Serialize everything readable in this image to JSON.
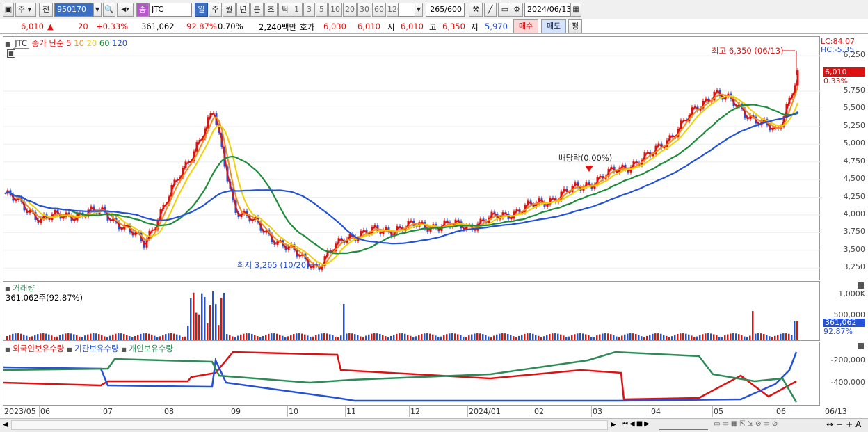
{
  "toolbar": {
    "period_select": "주",
    "prev_label": "전",
    "code": "950170",
    "type_badge": "종",
    "name": "JTC",
    "periods": [
      "일",
      "주",
      "월",
      "년",
      "분",
      "초",
      "틱"
    ],
    "active_period": "일",
    "intervals": [
      "1",
      "3",
      "5",
      "10",
      "20",
      "30",
      "60",
      "120"
    ],
    "count": "265",
    "count_total": "/600",
    "date": "2024/06/13"
  },
  "quote": {
    "price": "6,010",
    "direction": "▲",
    "change": "20",
    "change_pct": "+0.33%",
    "volume": "361,062",
    "vol_ratio": "92.87%",
    "turnover_pct": "0.70%",
    "amount": "2,240백만",
    "bid_label": "호가",
    "bid1": "6,030",
    "bid2": "6,010",
    "open_label": "시",
    "open": "6,010",
    "high_label": "고",
    "high": "6,350",
    "low_label": "저",
    "low": "5,970",
    "buy_label": "매수",
    "sell_label": "매도",
    "avg_label": "평"
  },
  "main_legend": {
    "code": "JTC",
    "name": "종가 단순",
    "ma": [
      "5",
      "10",
      "20",
      "60",
      "120"
    ],
    "ma_colors": [
      "#d11",
      "#f28c16",
      "#f0d000",
      "#1e8c3a",
      "#2451d6"
    ]
  },
  "price_axis": {
    "lc": "LC:84.07",
    "hc": "HC:-5.35",
    "ticks": [
      "6,250",
      "5,750",
      "5,500",
      "5,250",
      "5,000",
      "4,750",
      "4,500",
      "4,250",
      "4,000",
      "3,750",
      "3,500",
      "3,250"
    ],
    "current": "6,010",
    "current_pct": "0.33%"
  },
  "annotations": {
    "high": "최고 6,350 (06/13)",
    "low": "최저 3,265 (10/20)",
    "dividend": "배당락(0.00%)"
  },
  "volume_panel": {
    "title": "거래량",
    "value": "361,062주(92.87%)",
    "ticks": [
      "1,000K",
      "500,000"
    ],
    "current": "361,062",
    "current_pct": "92.87%"
  },
  "owner_panel": {
    "legend": [
      "외국인보유수량",
      "기관보유수량",
      "개인보유수량"
    ],
    "colors": [
      "#d11",
      "#2451d6",
      "#2e8b57"
    ],
    "ticks": [
      "-200,000",
      "-400,000"
    ]
  },
  "x_axis": [
    "2023/05",
    "06",
    "07",
    "08",
    "09",
    "10",
    "11",
    "12",
    "2024/01",
    "02",
    "03",
    "04",
    "05",
    "06"
  ],
  "x_end": "06/13",
  "chart_data": {
    "type": "line",
    "title": "JTC 950170 daily",
    "ylim": [
      3125,
      6350
    ],
    "close_series_approx": [
      {
        "date": "2023/05",
        "close": 4300
      },
      {
        "date": "2023/06",
        "close": 3950
      },
      {
        "date": "2023/07",
        "close": 4050
      },
      {
        "date": "2023/08",
        "close": 3600
      },
      {
        "date": "2023/08 late",
        "close": 5450
      },
      {
        "date": "2023/09",
        "close": 4100
      },
      {
        "date": "2023/10",
        "close": 3500
      },
      {
        "date": "2023/10/20",
        "close": 3265
      },
      {
        "date": "2023/11",
        "close": 3700
      },
      {
        "date": "2023/12",
        "close": 3850
      },
      {
        "date": "2024/01",
        "close": 3850
      },
      {
        "date": "2024/02",
        "close": 4150
      },
      {
        "date": "2024/03",
        "close": 4450
      },
      {
        "date": "2024/04",
        "close": 4850
      },
      {
        "date": "2024/05",
        "close": 5750
      },
      {
        "date": "2024/06",
        "close": 5150
      },
      {
        "date": "2024/06/13",
        "close": 6010
      }
    ]
  }
}
